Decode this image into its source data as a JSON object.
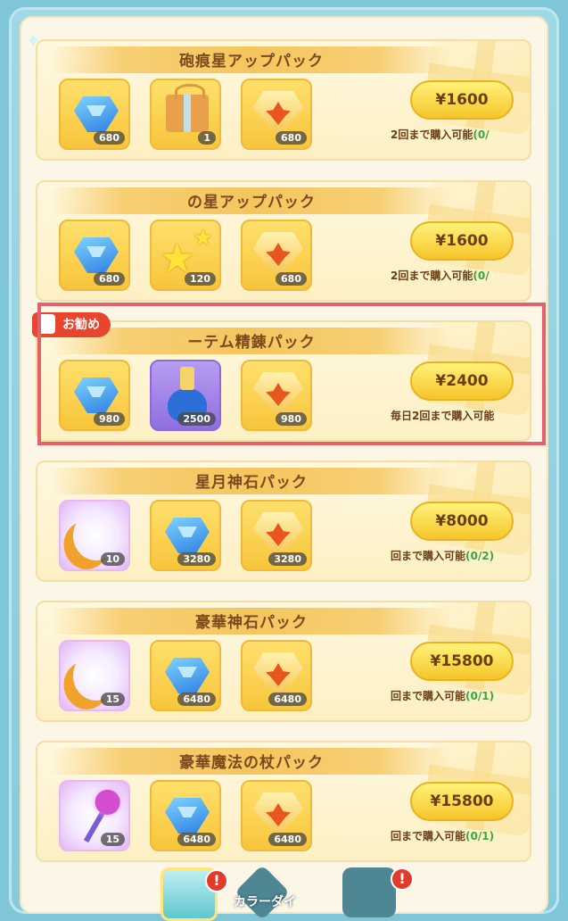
{
  "packs": [
    {
      "title": "砲痕星アップパック",
      "price": "¥1600",
      "limit": "2回まで購入可能",
      "count": "(0/",
      "items": [
        {
          "icon": "blue-gem-icon",
          "qty": "680"
        },
        {
          "icon": "gift-box-icon",
          "qty": "1"
        },
        {
          "icon": "maple-leaf-badge-icon",
          "qty": "680"
        }
      ]
    },
    {
      "title": "の星アップパック",
      "price": "¥1600",
      "limit": "2回まで購入可能",
      "count": "(0/",
      "items": [
        {
          "icon": "blue-gem-icon",
          "qty": "680"
        },
        {
          "icon": "stars-icon",
          "qty": "120"
        },
        {
          "icon": "maple-leaf-badge-icon",
          "qty": "680"
        }
      ]
    },
    {
      "title": "ーテム精錬パック",
      "price": "¥2400",
      "limit": "毎日2回まで購入可能",
      "count": "",
      "items": [
        {
          "icon": "blue-gem-icon",
          "qty": "980"
        },
        {
          "icon": "potion-flask-icon",
          "qty": "2500"
        },
        {
          "icon": "maple-leaf-badge-icon",
          "qty": "980"
        }
      ]
    },
    {
      "title": "星月神石パック",
      "price": "¥8000",
      "limit": "回まで購入可能",
      "count": "(0/2)",
      "items": [
        {
          "icon": "crescent-moon-icon",
          "qty": "10"
        },
        {
          "icon": "blue-gem-icon",
          "qty": "3280"
        },
        {
          "icon": "maple-leaf-badge-icon",
          "qty": "3280"
        }
      ]
    },
    {
      "title": "豪華神石パック",
      "price": "¥15800",
      "limit": "回まで購入可能",
      "count": "(0/1)",
      "items": [
        {
          "icon": "crescent-moon-icon",
          "qty": "15"
        },
        {
          "icon": "blue-gem-icon",
          "qty": "6480"
        },
        {
          "icon": "maple-leaf-badge-icon",
          "qty": "6480"
        }
      ]
    },
    {
      "title": "豪華魔法の杖パック",
      "price": "¥15800",
      "limit": "回まで購入可能",
      "count": "(0/1)",
      "items": [
        {
          "icon": "magic-staff-icon",
          "qty": "15"
        },
        {
          "icon": "blue-gem-icon",
          "qty": "6480"
        },
        {
          "icon": "maple-leaf-badge-icon",
          "qty": "6480"
        }
      ]
    }
  ],
  "recommend_badge": "お勧め",
  "bottom_tabs": {
    "label": "カラーダイ",
    "alert": "!"
  },
  "colors": {
    "highlight": "#e4606a",
    "accent": "#f6c52a",
    "badge": "#e7462e"
  }
}
